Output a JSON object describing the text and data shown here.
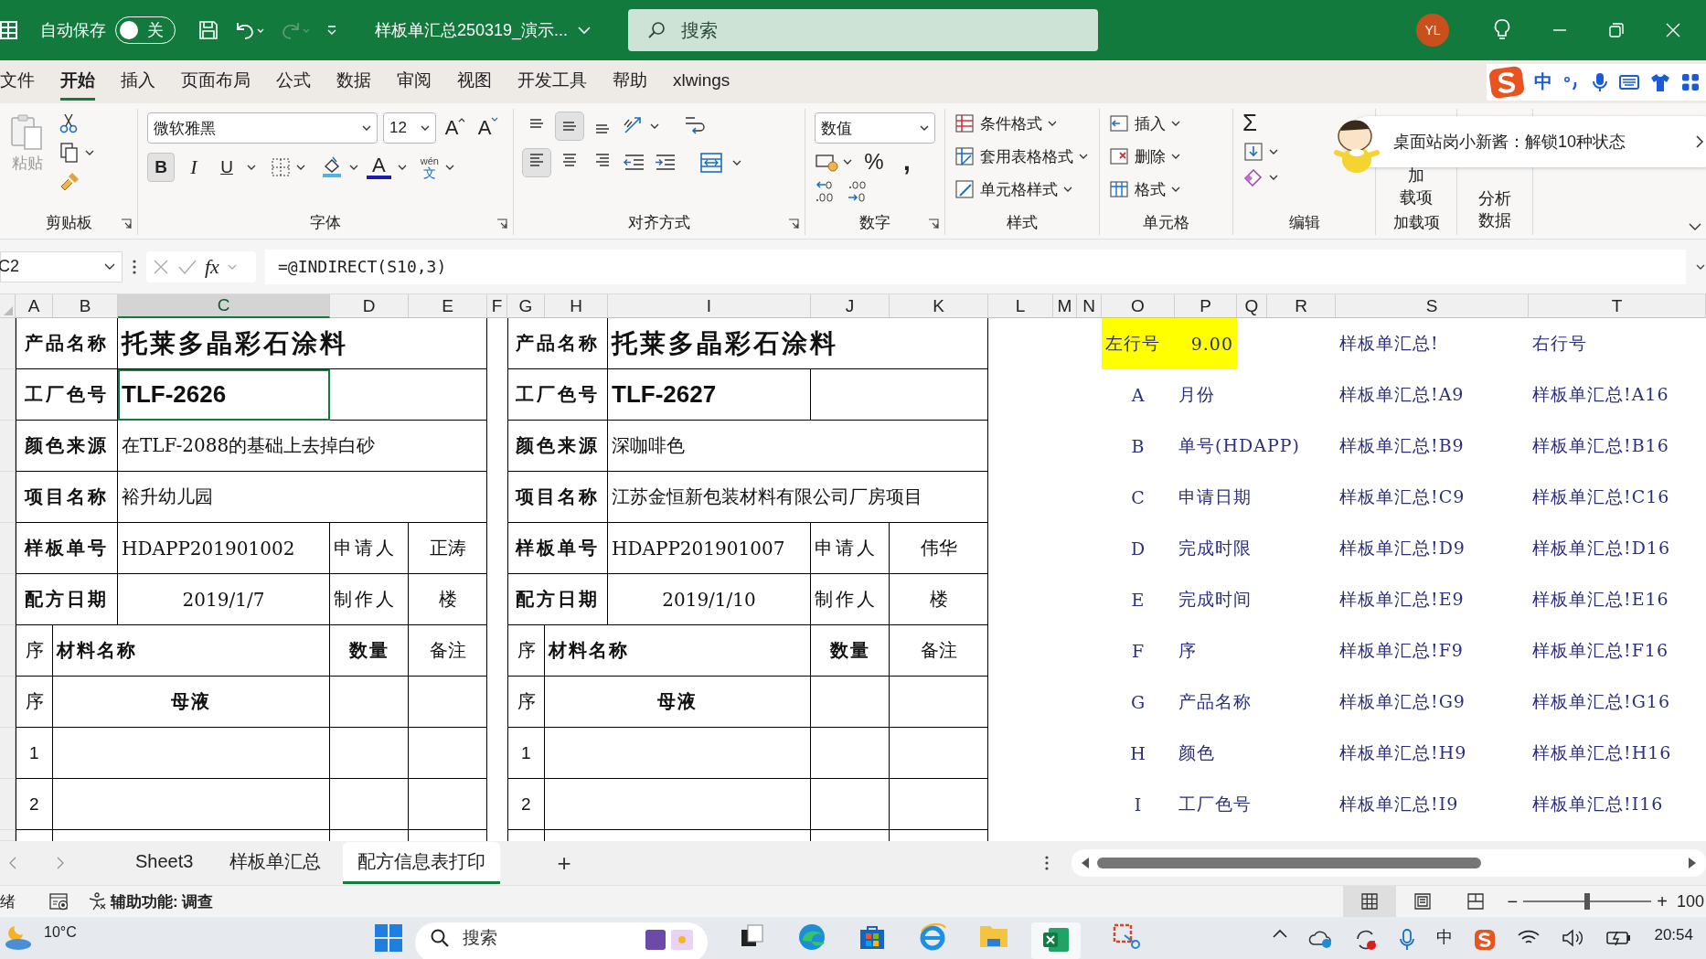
{
  "title_bar": {
    "autosave_label": "自动保存",
    "autosave": {
      "label": "关",
      "on": false
    },
    "filename": "样板单汇总250319_演示...",
    "search_placeholder": "搜索",
    "avatar": "YL"
  },
  "menu_tabs": [
    {
      "label": "文件",
      "selected": false
    },
    {
      "label": "开始",
      "selected": true
    },
    {
      "label": "插入",
      "selected": false
    },
    {
      "label": "页面布局",
      "selected": false
    },
    {
      "label": "公式",
      "selected": false
    },
    {
      "label": "数据",
      "selected": false
    },
    {
      "label": "审阅",
      "selected": false
    },
    {
      "label": "视图",
      "selected": false
    },
    {
      "label": "开发工具",
      "selected": false
    },
    {
      "label": "帮助",
      "selected": false
    },
    {
      "label": "xlwings",
      "selected": false
    }
  ],
  "ime_toolbar": {
    "mode": "中"
  },
  "ribbon": {
    "clipboard": {
      "paste": "粘贴",
      "label": "剪贴板"
    },
    "font": {
      "font_name": "微软雅黑",
      "font_size": "12",
      "grow": "A",
      "shrink": "A",
      "bold": {
        "label": "B",
        "pressed": true
      },
      "italic": {
        "label": "I",
        "pressed": false
      },
      "underline": {
        "label": "U",
        "pressed": false
      },
      "font_color": "A",
      "phonetic_top": "wén",
      "phonetic_bottom": "文",
      "label": "字体"
    },
    "alignment": {
      "vertical_buttons": [
        {
          "kind": "top",
          "pressed": false
        },
        {
          "kind": "middle",
          "pressed": true
        },
        {
          "kind": "bottom",
          "pressed": false
        }
      ],
      "horizontal_buttons": [
        {
          "kind": "left",
          "pressed": true
        },
        {
          "kind": "center",
          "pressed": false
        },
        {
          "kind": "right",
          "pressed": false
        }
      ],
      "label": "对齐方式"
    },
    "number": {
      "format": "数值",
      "percent": "%",
      "comma": ",",
      "label": "数字"
    },
    "styles": {
      "items": [
        "条件格式",
        "套用表格格式",
        "单元格样式"
      ],
      "label": "样式"
    },
    "cells": {
      "items": [
        "插入",
        "删除",
        "格式"
      ],
      "label": "单元格"
    },
    "editing": {
      "sum": "Σ",
      "label": "编辑"
    },
    "addins": {
      "lines": [
        "加",
        "载项"
      ],
      "label": "加载项"
    },
    "analysis": {
      "lines": [
        "分析",
        "数据"
      ]
    }
  },
  "notification": {
    "text": "桌面站岗小新酱：解锁10种状态"
  },
  "formula_bar": {
    "name_box": "C2",
    "fx": "fx",
    "formula": "=@INDIRECT(S10,3)"
  },
  "column_headers": [
    {
      "label": "A",
      "selected": false
    },
    {
      "label": "B",
      "selected": false
    },
    {
      "label": "C",
      "selected": true
    },
    {
      "label": "D",
      "selected": false
    },
    {
      "label": "E",
      "selected": false
    },
    {
      "label": "F",
      "selected": false
    },
    {
      "label": "G",
      "selected": false
    },
    {
      "label": "H",
      "selected": false
    },
    {
      "label": "I",
      "selected": false
    },
    {
      "label": "J",
      "selected": false
    },
    {
      "label": "K",
      "selected": false
    },
    {
      "label": "L",
      "selected": false
    },
    {
      "label": "M",
      "selected": false
    },
    {
      "label": "N",
      "selected": false
    },
    {
      "label": "O",
      "selected": false
    },
    {
      "label": "P",
      "selected": false
    },
    {
      "label": "Q",
      "selected": false
    },
    {
      "label": "R",
      "selected": false
    },
    {
      "label": "S",
      "selected": false
    },
    {
      "label": "T",
      "selected": false
    }
  ],
  "forms": [
    {
      "fields": [
        {
          "label": "产品名称",
          "value": "托莱多晶彩石涂料",
          "kind": "title"
        },
        {
          "label": "工厂色号",
          "value": "TLF-2626",
          "kind": "code",
          "selected": true
        },
        {
          "label": "颜色来源",
          "value": "在TLF-2088的基础上去掉白砂",
          "kind": "text"
        },
        {
          "label": "项目名称",
          "value": "裕升幼儿园",
          "kind": "text"
        },
        {
          "label": "样板单号",
          "value": "HDAPP201901002",
          "kind": "order_no",
          "person_label": "申请人",
          "person": "正涛"
        },
        {
          "label": "配方日期",
          "value": "2019/1/7",
          "kind": "date",
          "person_label": "制作人",
          "person": "楼"
        }
      ],
      "materials_header": {
        "index": "序",
        "name": "材料名称",
        "quantity": "数量",
        "note": "备注"
      },
      "section_row": {
        "index": "序",
        "name": "母液"
      },
      "item_rows": [
        {
          "index": "1"
        },
        {
          "index": "2"
        }
      ]
    },
    {
      "fields": [
        {
          "label": "产品名称",
          "value": "托莱多晶彩石涂料",
          "kind": "title"
        },
        {
          "label": "工厂色号",
          "value": "TLF-2627",
          "kind": "code",
          "selected": false
        },
        {
          "label": "颜色来源",
          "value": "深咖啡色",
          "kind": "text"
        },
        {
          "label": "项目名称",
          "value": "江苏金恒新包装材料有限公司厂房项目",
          "kind": "text"
        },
        {
          "label": "样板单号",
          "value": "HDAPP201901007",
          "kind": "order_no",
          "person_label": "申请人",
          "person": "伟华"
        },
        {
          "label": "配方日期",
          "value": "2019/1/10",
          "kind": "date",
          "person_label": "制作人",
          "person": "楼"
        }
      ],
      "materials_header": {
        "index": "序",
        "name": "材料名称",
        "quantity": "数量",
        "note": "备注"
      },
      "section_row": {
        "index": "序",
        "name": "母液"
      },
      "item_rows": [
        {
          "index": "1"
        },
        {
          "index": "2"
        }
      ]
    }
  ],
  "lookup": {
    "header": {
      "left_label": "左行号",
      "left_value": "9.00",
      "sheet_ref": "样板单汇总!",
      "right_label": "右行号"
    },
    "rows": [
      {
        "column": "A",
        "field": "月份",
        "left_ref": "样板单汇总!A9",
        "right_ref": "样板单汇总!A16"
      },
      {
        "column": "B",
        "field": "单号(HDAPP)",
        "left_ref": "样板单汇总!B9",
        "right_ref": "样板单汇总!B16"
      },
      {
        "column": "C",
        "field": "申请日期",
        "left_ref": "样板单汇总!C9",
        "right_ref": "样板单汇总!C16"
      },
      {
        "column": "D",
        "field": "完成时限",
        "left_ref": "样板单汇总!D9",
        "right_ref": "样板单汇总!D16"
      },
      {
        "column": "E",
        "field": "完成时间",
        "left_ref": "样板单汇总!E9",
        "right_ref": "样板单汇总!E16"
      },
      {
        "column": "F",
        "field": "序",
        "left_ref": "样板单汇总!F9",
        "right_ref": "样板单汇总!F16"
      },
      {
        "column": "G",
        "field": "产品名称",
        "left_ref": "样板单汇总!G9",
        "right_ref": "样板单汇总!G16"
      },
      {
        "column": "H",
        "field": "颜色",
        "left_ref": "样板单汇总!H9",
        "right_ref": "样板单汇总!H16"
      },
      {
        "column": "I",
        "field": "工厂色号",
        "left_ref": "样板单汇总!I9",
        "right_ref": "样板单汇总!I16"
      }
    ]
  },
  "sheet_tabs": [
    {
      "label": "Sheet3",
      "selected": false
    },
    {
      "label": "样板单汇总",
      "selected": false
    },
    {
      "label": "配方信息表打印",
      "selected": true
    }
  ],
  "add_sheet": "+",
  "status_bar": {
    "ready": "绪",
    "accessibility": "辅助功能: 调查",
    "views": [
      {
        "kind": "normal",
        "selected": true
      },
      {
        "kind": "page_layout",
        "selected": false
      },
      {
        "kind": "page_break",
        "selected": false
      }
    ],
    "zoom": {
      "minus": "−",
      "plus": "+",
      "level": 0.5,
      "percent": "100"
    }
  },
  "taskbar": {
    "temperature": "10°C",
    "search_placeholder": "搜索",
    "ime": "中",
    "time": "20:54"
  }
}
